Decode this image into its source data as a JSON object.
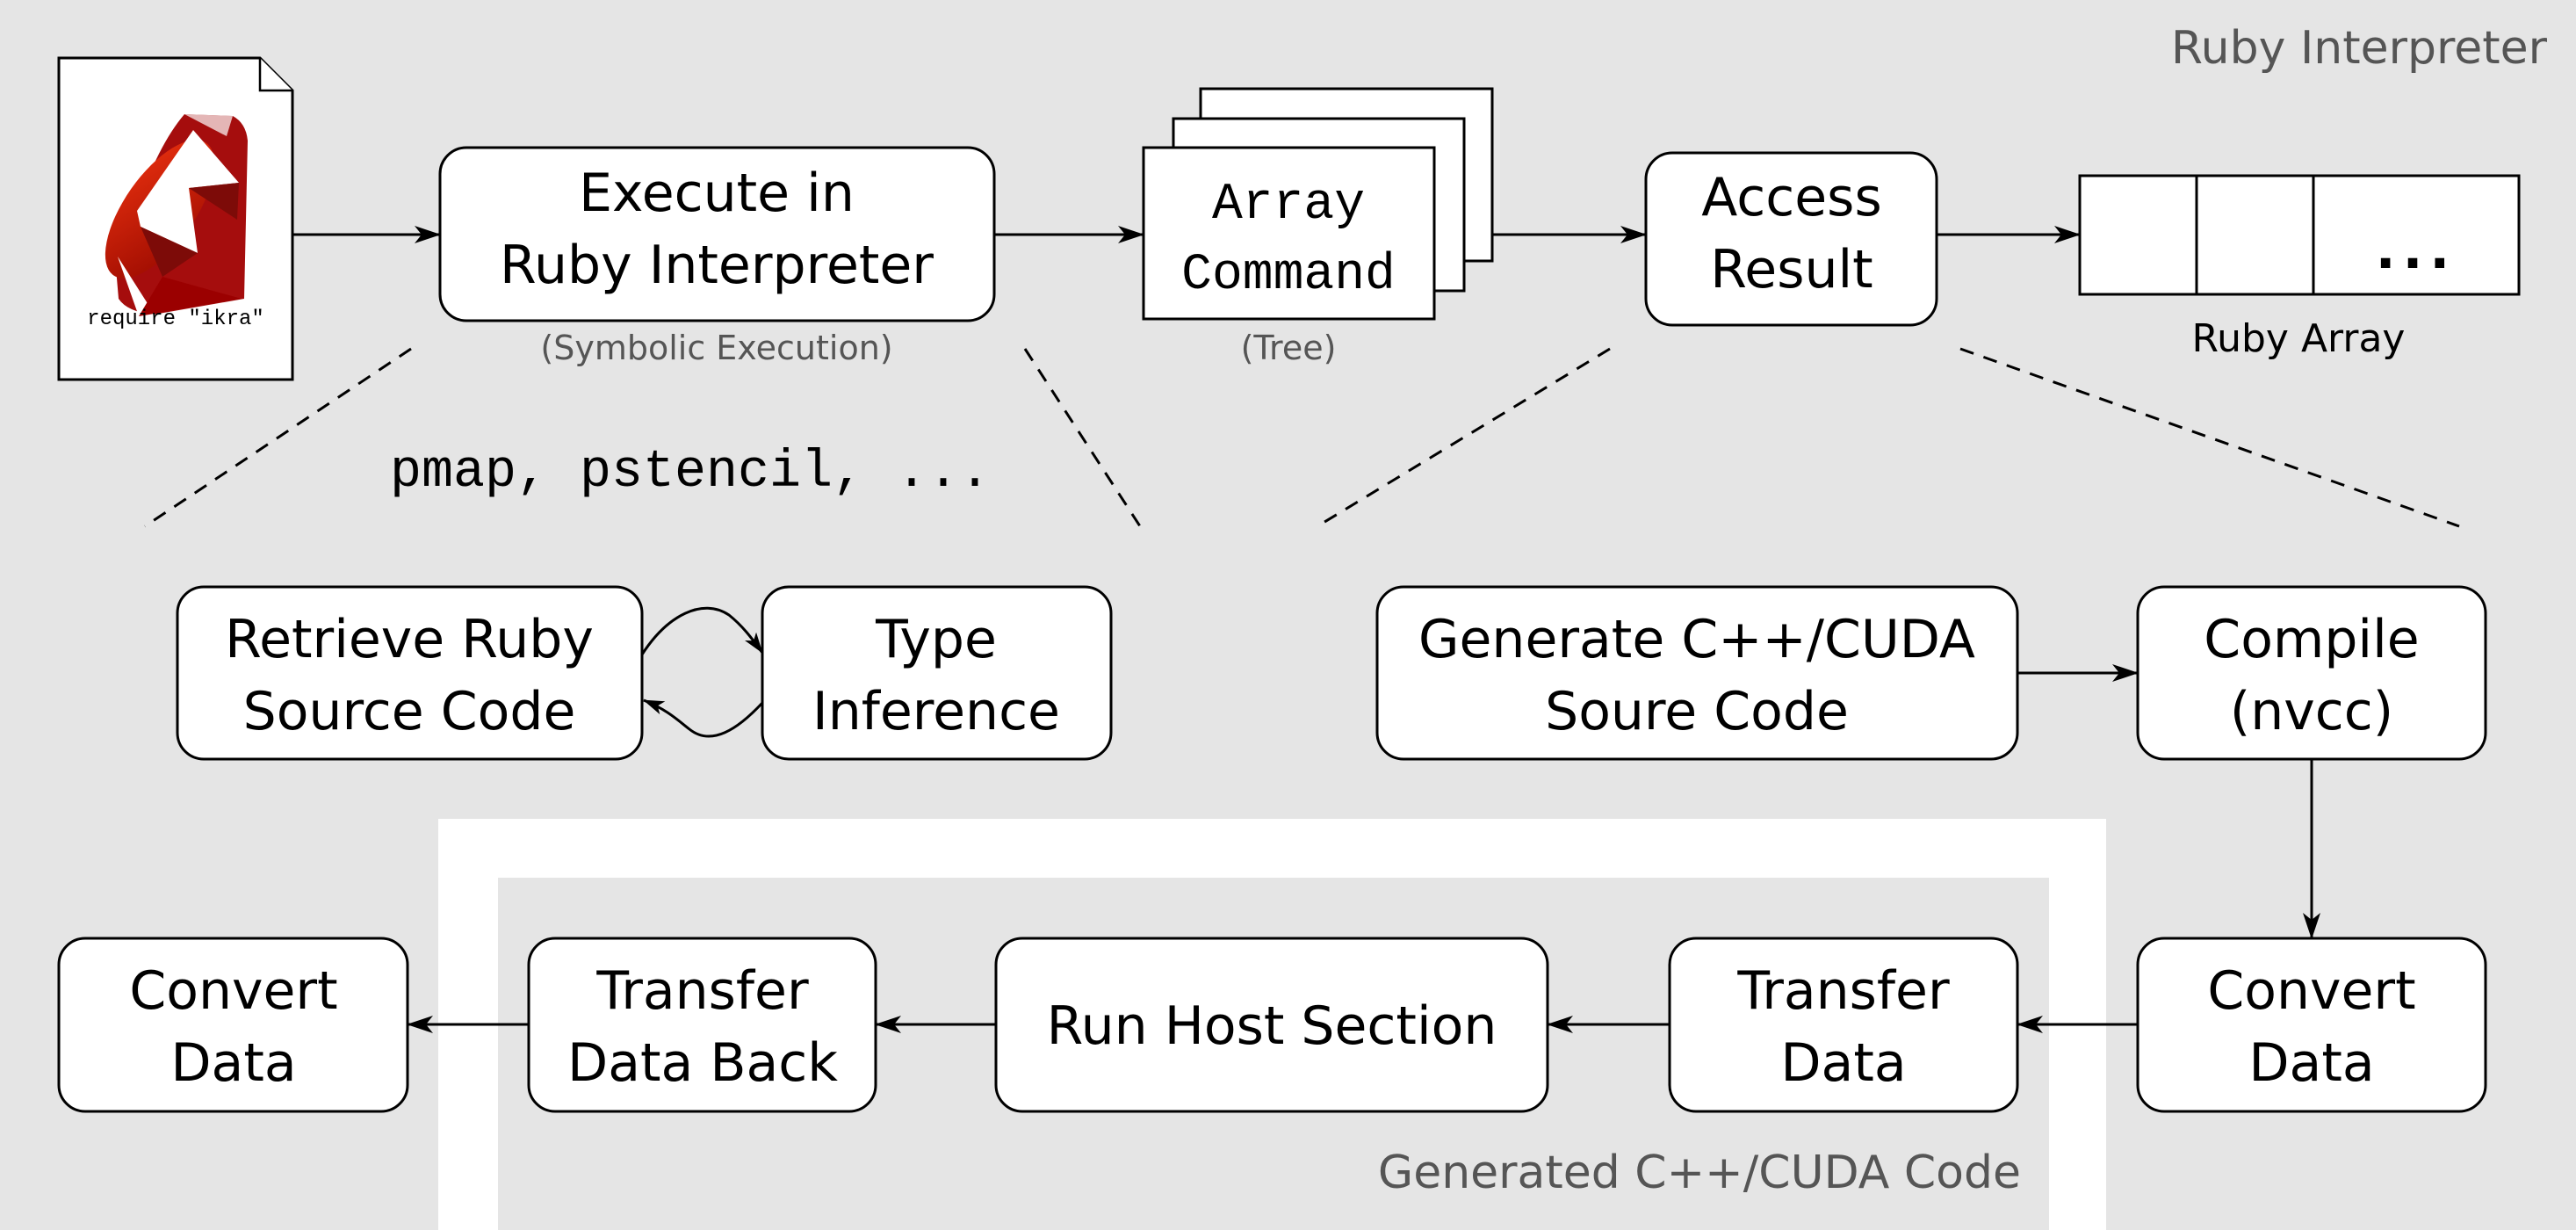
{
  "regions": {
    "ruby_interpreter": {
      "label": "Ruby Interpreter",
      "color": "#e5e5e5"
    },
    "generated_code": {
      "label": "Generated C++/CUDA Code",
      "color": "#e5e5e5",
      "border_color": "#ffffff"
    }
  },
  "source_file": {
    "icon": "ruby-gem-icon",
    "code": "require \"ikra\""
  },
  "top_row": {
    "execute": {
      "line1": "Execute in",
      "line2": "Ruby Interpreter",
      "caption": "(Symbolic Execution)"
    },
    "array_command": {
      "line1": "Array",
      "line2": "Command",
      "caption": "(Tree)"
    },
    "access_result": {
      "line1": "Access",
      "line2": "Result"
    },
    "ruby_array": {
      "ellipsis": "...",
      "caption": "Ruby Array"
    }
  },
  "middle": {
    "methods_text": "pmap, pstencil, ...",
    "retrieve": {
      "line1": "Retrieve Ruby",
      "line2": "Source Code"
    },
    "type_inference": {
      "line1": "Type",
      "line2": "Inference"
    },
    "generate": {
      "line1": "Generate C++/CUDA",
      "line2": "Soure Code"
    },
    "compile": {
      "line1": "Compile",
      "line2": "(nvcc)"
    }
  },
  "bottom_row": {
    "convert_left": {
      "line1": "Convert",
      "line2": "Data"
    },
    "transfer_back": {
      "line1": "Transfer",
      "line2": "Data Back"
    },
    "run_host": {
      "line1": "Run Host Section"
    },
    "transfer": {
      "line1": "Transfer",
      "line2": "Data"
    },
    "convert_right": {
      "line1": "Convert",
      "line2": "Data"
    }
  },
  "colors": {
    "background": "#e5e5e5",
    "box_fill": "#ffffff",
    "stroke": "#000000",
    "caption": "#555555",
    "ruby_red": "#cc1100"
  }
}
